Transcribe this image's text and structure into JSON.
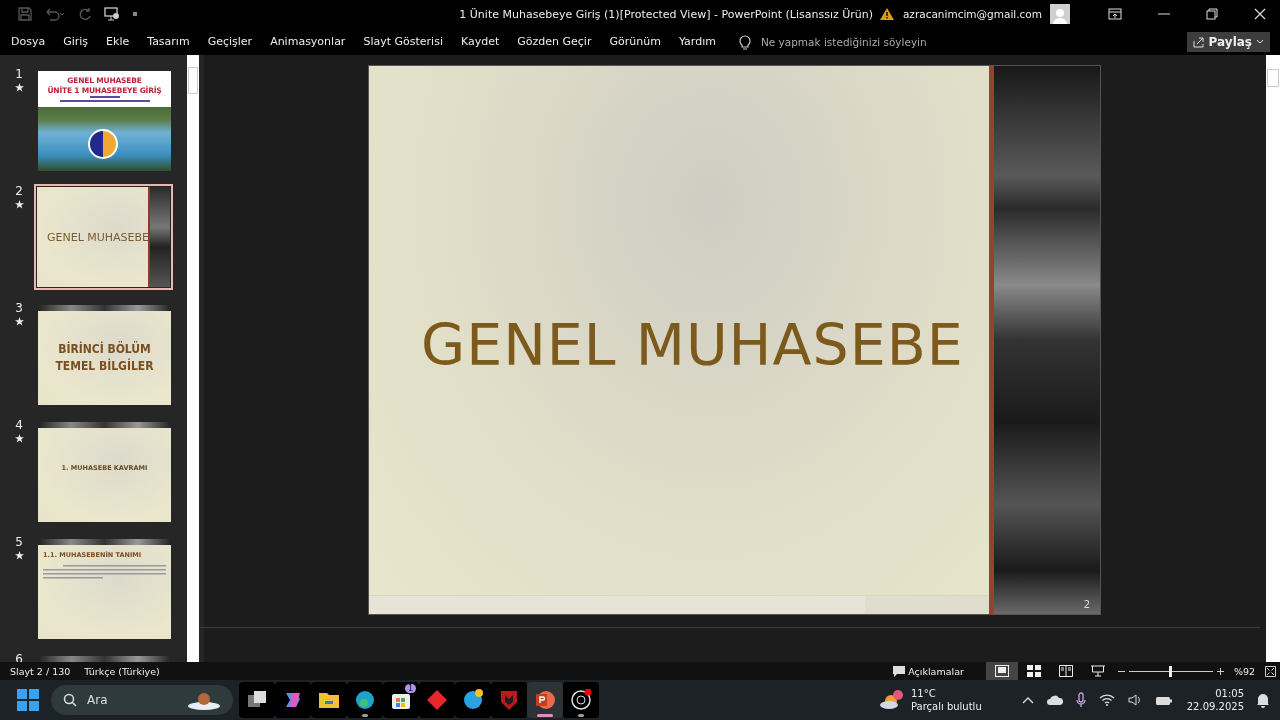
{
  "window": {
    "title": "1 Ünite Muhasebeye Giriş (1)[Protected View]  -  PowerPoint (Lisanssız Ürün)",
    "account": "azracanimcim@gmail.com"
  },
  "ribbon_tabs": [
    "Dosya",
    "Giriş",
    "Ekle",
    "Tasarım",
    "Geçişler",
    "Animasyonlar",
    "Slayt Gösterisi",
    "Kaydet",
    "Gözden Geçir",
    "Görünüm",
    "Yardım"
  ],
  "tell_me": {
    "placeholder": "Ne yapmak istediğinizi söyleyin"
  },
  "share_button": "Paylaş",
  "slides": [
    {
      "number": "1",
      "kind": "photo-title",
      "selected": false,
      "texts": [
        "GENEL MUHASEBE",
        "ÜNİTE 1 MUHASEBEYE GİRİŞ"
      ]
    },
    {
      "number": "2",
      "kind": "title",
      "selected": true,
      "texts": [
        "GENEL MUHASEBE"
      ]
    },
    {
      "number": "3",
      "kind": "section",
      "selected": false,
      "texts": [
        "BİRİNCİ BÖLÜM",
        "TEMEL BİLGİLER"
      ]
    },
    {
      "number": "4",
      "kind": "heading",
      "selected": false,
      "texts": [
        "1. MUHASEBE KAVRAMI"
      ]
    },
    {
      "number": "5",
      "kind": "text",
      "selected": false,
      "texts": [
        "1.1. MUHASEBENİN TANIMI"
      ]
    },
    {
      "number": "6",
      "kind": "partial",
      "selected": false
    }
  ],
  "current_slide": {
    "title": "GENEL MUHASEBE",
    "number": "2"
  },
  "status_bar": {
    "slide_position": "Slayt 2 / 130",
    "language": "Türkçe (Türkiye)",
    "comments": "Açıklamalar",
    "views": [
      {
        "kind": "normal",
        "selected": true
      },
      {
        "kind": "sorter",
        "selected": false
      },
      {
        "kind": "reading",
        "selected": false
      },
      {
        "kind": "slideshow",
        "selected": false
      }
    ],
    "zoom": {
      "label": "%92",
      "level": 0.49
    }
  },
  "taskbar": {
    "search": {
      "placeholder": "Ara"
    },
    "apps": [
      {
        "kind": "task-view",
        "active": false
      },
      {
        "kind": "copilot",
        "active": false
      },
      {
        "kind": "folder",
        "active": false
      },
      {
        "kind": "edge",
        "active": true
      },
      {
        "kind": "store",
        "active": false,
        "badge": "1"
      },
      {
        "kind": "diamond",
        "active": false
      },
      {
        "kind": "help",
        "active": false
      },
      {
        "kind": "shield",
        "active": false
      },
      {
        "kind": "powerpoint",
        "active": true
      },
      {
        "kind": "obs",
        "active": true
      }
    ],
    "weather": {
      "temperature": "11°C",
      "condition": "Parçalı bulutlu"
    },
    "clock": {
      "time": "01:05",
      "date": "22.09.2025"
    }
  }
}
